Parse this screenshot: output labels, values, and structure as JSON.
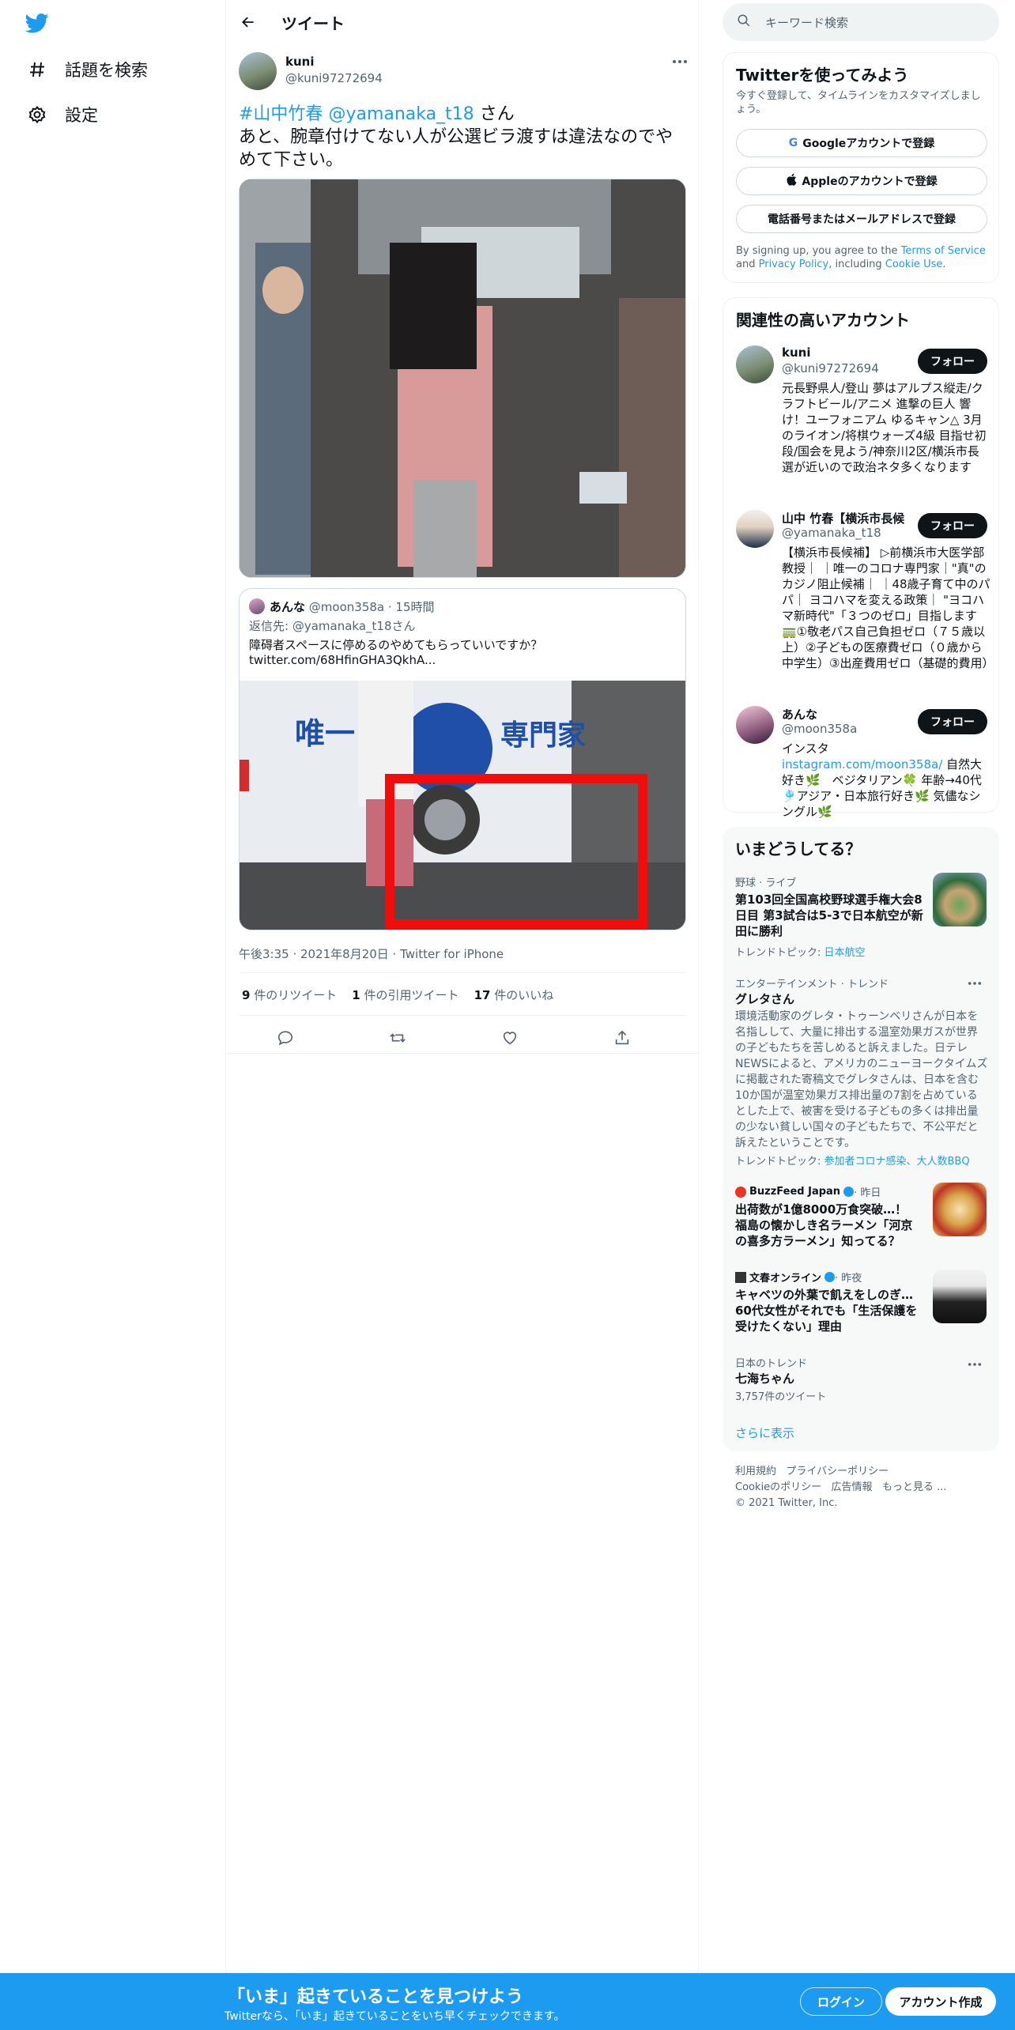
{
  "nav": {
    "explore_label": "話題を検索",
    "settings_label": "設定"
  },
  "header": {
    "title": "ツイート"
  },
  "tweet": {
    "author_name": "kuni",
    "author_handle": "@kuni97272694",
    "hashtag": "#山中竹春",
    "mention": "@yamanaka_t18",
    "san": " さん",
    "body": "あと、腕章付けてない人が公選ビラ渡すは違法なのでやめて下さい。",
    "timestamp": "午後3:35 · 2021年8月20日 · Twitter for iPhone",
    "retweets_count": "9",
    "retweets_label": " 件のリツイート",
    "quotes_count": "1",
    "quotes_label": " 件の引用ツイート",
    "likes_count": "17",
    "likes_label": " 件のいいね"
  },
  "quote": {
    "author_name": "あんな",
    "author_meta": "@moon358a · 15時間",
    "reply_prefix": "返信先: ",
    "reply_to": "@yamanaka_t18さん",
    "text": "障碍者スペースに停めるのやめてもらっていいですか？",
    "link": "twitter.com/68HfinGHA3QkhA...",
    "van_text": "唯一",
    "van_text2": "専門家"
  },
  "search": {
    "placeholder": "キーワード検索"
  },
  "signup": {
    "title": "Twitterを使ってみよう",
    "desc": "今すぐ登録して、タイムラインをカスタマイズしましょう。",
    "google": "Googleアカウントで登録",
    "apple": "Appleのアカウントで登録",
    "phone": "電話番号またはメールアドレスで登録",
    "terms_1": "By signing up, you agree to the ",
    "terms_link": "Terms of Service",
    "terms_2": " and ",
    "privacy_link": "Privacy Policy",
    "terms_3": ", including ",
    "cookie_link": "Cookie Use",
    "terms_4": "."
  },
  "related": {
    "title": "関連性の高いアカウント",
    "follow_label": "フォロー",
    "accounts": [
      {
        "name": "kuni",
        "handle": "@kuni97272694",
        "bio": "元長野県人/登山 夢はアルプス縦走/クラフトビール/アニメ 進撃の巨人 響け！ユーフォニアム ゆるキャン△ 3月のライオン/将棋ウォーズ4級 目指せ初段/国会を見よう/神奈川2区/横浜市長選が近いので政治ネタ多くなります"
      },
      {
        "name": "山中 竹春【横浜市長候",
        "handle": "@yamanaka_t18",
        "bio": "【横浜市長候補】 ▷前横浜市大医学部教授｜ ｜唯一のコロナ専門家｜\"真\"のカジノ阻止候補｜ ｜48歳子育て中のパパ｜ ヨコハマを変える政策｜ \"ヨコハマ新時代\"「３つのゼロ」目指します🚃①敬老パス自己負担ゼロ（７５歳以上）②子どもの医療費ゼロ（０歳から中学生）③出産費用ゼロ（基礎的費用）"
      },
      {
        "name": "あんな",
        "handle": "@moon358a",
        "bio_1": "インスタ ",
        "bio_link": "instagram.com/moon358a/",
        "bio_2": " 自然大好き🌿　ベジタリアン🍀 年齢→40代　🎐アジア・日本旅行好き🌿 気儘なシングル🌿"
      }
    ]
  },
  "trends": {
    "title": "いまどうしてる？",
    "items": [
      {
        "category": "野球 · ライブ",
        "title": "第103回全国高校野球選手権大会8日目 第3試合は5-3で日本航空が新田に勝利",
        "topic_prefix": "トレンドトピック: ",
        "topic": "日本航空"
      },
      {
        "category": "エンターテインメント · トレンド",
        "title": "グレタさん",
        "desc": "環境活動家のグレタ・トゥーンベリさんが日本を名指しして、大量に排出する温室効果ガスが世界の子どもたちを苦しめると訴えました。日テレNEWSによると、アメリカのニューヨークタイムズに掲載された寄稿文でグレタさんは、日本を含む10か国が温室効果ガス排出量の7割を占めているとした上で、被害を受ける子どもの多くは排出量の少ない貧しい国々の子どもたちで、不公平だと訴えたということです。",
        "topic_prefix": "トレンドトピック: ",
        "topic": "参加者コロナ感染、大人数BBQ"
      },
      {
        "source": "BuzzFeed Japan",
        "time": " · 昨日",
        "title": "出荷数が1億8000万食突破…！ 福島の懐かしき名ラーメン「河京の喜多方ラーメン」知ってる？"
      },
      {
        "source": "文春オンライン",
        "time": " · 昨夜",
        "title": "キャベツの外葉で飢えをしのぎ… 60代女性がそれでも「生活保護を受けたくない」理由"
      },
      {
        "category": "日本のトレンド",
        "title": "七海ちゃん",
        "count": "3,757件のツイート"
      }
    ],
    "show_more": "さらに表示"
  },
  "footer": {
    "links": [
      "利用規約",
      "プライバシーポリシー",
      "Cookieのポリシー",
      "広告情報",
      "もっと見る ..."
    ],
    "copyright": "© 2021 Twitter, Inc."
  },
  "bottom": {
    "headline": "「いま」起きていることを見つけよう",
    "sub": "Twitterなら、「いま」起きていることをいち早くチェックできます。",
    "login": "ログイン",
    "signup": "アカウント作成"
  },
  "colors": {
    "accent": "#1d9bf0",
    "text": "#0f1419",
    "muted": "#536471"
  }
}
